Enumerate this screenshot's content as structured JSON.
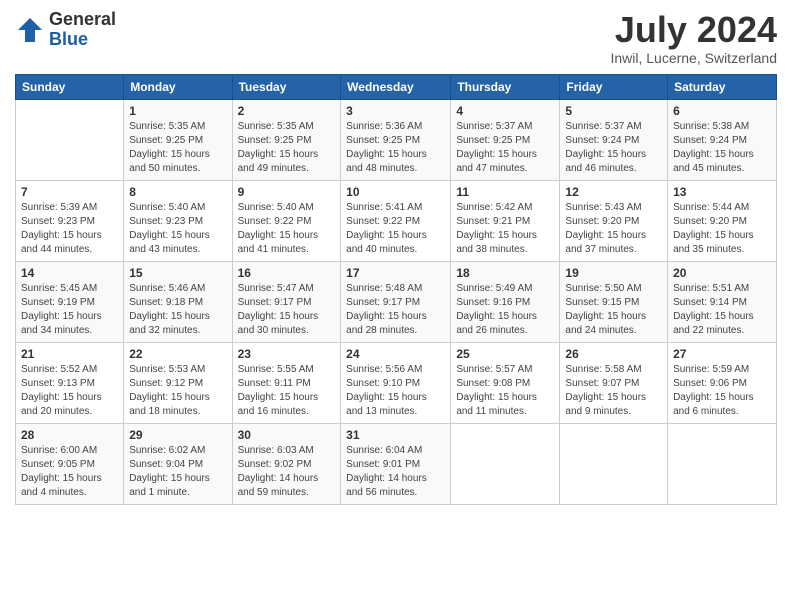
{
  "logo": {
    "general": "General",
    "blue": "Blue"
  },
  "title": {
    "month_year": "July 2024",
    "location": "Inwil, Lucerne, Switzerland"
  },
  "columns": [
    "Sunday",
    "Monday",
    "Tuesday",
    "Wednesday",
    "Thursday",
    "Friday",
    "Saturday"
  ],
  "weeks": [
    [
      {
        "day": "",
        "sunrise": "",
        "sunset": "",
        "daylight": ""
      },
      {
        "day": "1",
        "sunrise": "Sunrise: 5:35 AM",
        "sunset": "Sunset: 9:25 PM",
        "daylight": "Daylight: 15 hours and 50 minutes."
      },
      {
        "day": "2",
        "sunrise": "Sunrise: 5:35 AM",
        "sunset": "Sunset: 9:25 PM",
        "daylight": "Daylight: 15 hours and 49 minutes."
      },
      {
        "day": "3",
        "sunrise": "Sunrise: 5:36 AM",
        "sunset": "Sunset: 9:25 PM",
        "daylight": "Daylight: 15 hours and 48 minutes."
      },
      {
        "day": "4",
        "sunrise": "Sunrise: 5:37 AM",
        "sunset": "Sunset: 9:25 PM",
        "daylight": "Daylight: 15 hours and 47 minutes."
      },
      {
        "day": "5",
        "sunrise": "Sunrise: 5:37 AM",
        "sunset": "Sunset: 9:24 PM",
        "daylight": "Daylight: 15 hours and 46 minutes."
      },
      {
        "day": "6",
        "sunrise": "Sunrise: 5:38 AM",
        "sunset": "Sunset: 9:24 PM",
        "daylight": "Daylight: 15 hours and 45 minutes."
      }
    ],
    [
      {
        "day": "7",
        "sunrise": "Sunrise: 5:39 AM",
        "sunset": "Sunset: 9:23 PM",
        "daylight": "Daylight: 15 hours and 44 minutes."
      },
      {
        "day": "8",
        "sunrise": "Sunrise: 5:40 AM",
        "sunset": "Sunset: 9:23 PM",
        "daylight": "Daylight: 15 hours and 43 minutes."
      },
      {
        "day": "9",
        "sunrise": "Sunrise: 5:40 AM",
        "sunset": "Sunset: 9:22 PM",
        "daylight": "Daylight: 15 hours and 41 minutes."
      },
      {
        "day": "10",
        "sunrise": "Sunrise: 5:41 AM",
        "sunset": "Sunset: 9:22 PM",
        "daylight": "Daylight: 15 hours and 40 minutes."
      },
      {
        "day": "11",
        "sunrise": "Sunrise: 5:42 AM",
        "sunset": "Sunset: 9:21 PM",
        "daylight": "Daylight: 15 hours and 38 minutes."
      },
      {
        "day": "12",
        "sunrise": "Sunrise: 5:43 AM",
        "sunset": "Sunset: 9:20 PM",
        "daylight": "Daylight: 15 hours and 37 minutes."
      },
      {
        "day": "13",
        "sunrise": "Sunrise: 5:44 AM",
        "sunset": "Sunset: 9:20 PM",
        "daylight": "Daylight: 15 hours and 35 minutes."
      }
    ],
    [
      {
        "day": "14",
        "sunrise": "Sunrise: 5:45 AM",
        "sunset": "Sunset: 9:19 PM",
        "daylight": "Daylight: 15 hours and 34 minutes."
      },
      {
        "day": "15",
        "sunrise": "Sunrise: 5:46 AM",
        "sunset": "Sunset: 9:18 PM",
        "daylight": "Daylight: 15 hours and 32 minutes."
      },
      {
        "day": "16",
        "sunrise": "Sunrise: 5:47 AM",
        "sunset": "Sunset: 9:17 PM",
        "daylight": "Daylight: 15 hours and 30 minutes."
      },
      {
        "day": "17",
        "sunrise": "Sunrise: 5:48 AM",
        "sunset": "Sunset: 9:17 PM",
        "daylight": "Daylight: 15 hours and 28 minutes."
      },
      {
        "day": "18",
        "sunrise": "Sunrise: 5:49 AM",
        "sunset": "Sunset: 9:16 PM",
        "daylight": "Daylight: 15 hours and 26 minutes."
      },
      {
        "day": "19",
        "sunrise": "Sunrise: 5:50 AM",
        "sunset": "Sunset: 9:15 PM",
        "daylight": "Daylight: 15 hours and 24 minutes."
      },
      {
        "day": "20",
        "sunrise": "Sunrise: 5:51 AM",
        "sunset": "Sunset: 9:14 PM",
        "daylight": "Daylight: 15 hours and 22 minutes."
      }
    ],
    [
      {
        "day": "21",
        "sunrise": "Sunrise: 5:52 AM",
        "sunset": "Sunset: 9:13 PM",
        "daylight": "Daylight: 15 hours and 20 minutes."
      },
      {
        "day": "22",
        "sunrise": "Sunrise: 5:53 AM",
        "sunset": "Sunset: 9:12 PM",
        "daylight": "Daylight: 15 hours and 18 minutes."
      },
      {
        "day": "23",
        "sunrise": "Sunrise: 5:55 AM",
        "sunset": "Sunset: 9:11 PM",
        "daylight": "Daylight: 15 hours and 16 minutes."
      },
      {
        "day": "24",
        "sunrise": "Sunrise: 5:56 AM",
        "sunset": "Sunset: 9:10 PM",
        "daylight": "Daylight: 15 hours and 13 minutes."
      },
      {
        "day": "25",
        "sunrise": "Sunrise: 5:57 AM",
        "sunset": "Sunset: 9:08 PM",
        "daylight": "Daylight: 15 hours and 11 minutes."
      },
      {
        "day": "26",
        "sunrise": "Sunrise: 5:58 AM",
        "sunset": "Sunset: 9:07 PM",
        "daylight": "Daylight: 15 hours and 9 minutes."
      },
      {
        "day": "27",
        "sunrise": "Sunrise: 5:59 AM",
        "sunset": "Sunset: 9:06 PM",
        "daylight": "Daylight: 15 hours and 6 minutes."
      }
    ],
    [
      {
        "day": "28",
        "sunrise": "Sunrise: 6:00 AM",
        "sunset": "Sunset: 9:05 PM",
        "daylight": "Daylight: 15 hours and 4 minutes."
      },
      {
        "day": "29",
        "sunrise": "Sunrise: 6:02 AM",
        "sunset": "Sunset: 9:04 PM",
        "daylight": "Daylight: 15 hours and 1 minute."
      },
      {
        "day": "30",
        "sunrise": "Sunrise: 6:03 AM",
        "sunset": "Sunset: 9:02 PM",
        "daylight": "Daylight: 14 hours and 59 minutes."
      },
      {
        "day": "31",
        "sunrise": "Sunrise: 6:04 AM",
        "sunset": "Sunset: 9:01 PM",
        "daylight": "Daylight: 14 hours and 56 minutes."
      },
      {
        "day": "",
        "sunrise": "",
        "sunset": "",
        "daylight": ""
      },
      {
        "day": "",
        "sunrise": "",
        "sunset": "",
        "daylight": ""
      },
      {
        "day": "",
        "sunrise": "",
        "sunset": "",
        "daylight": ""
      }
    ]
  ]
}
